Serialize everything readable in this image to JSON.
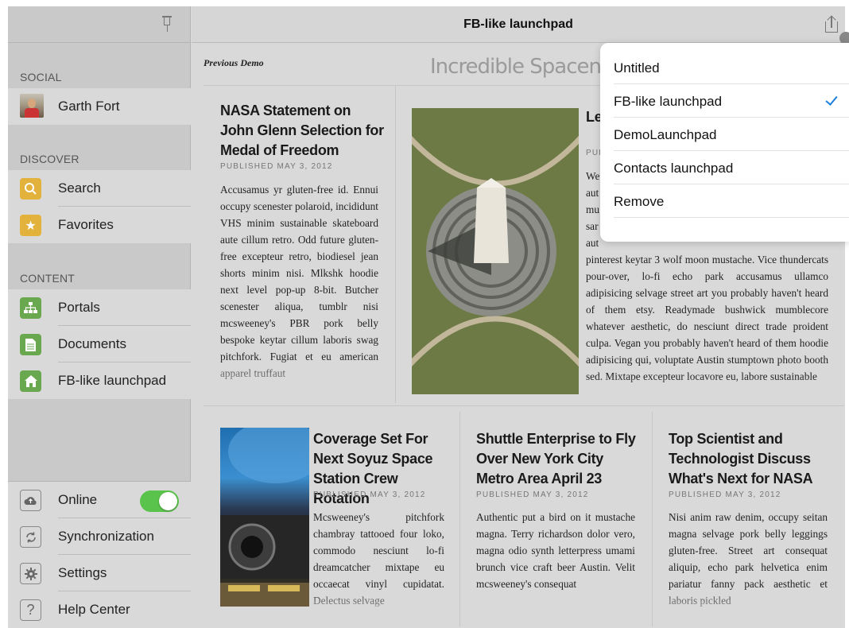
{
  "header": {
    "title": "FB-like launchpad"
  },
  "sidebar": {
    "sections": [
      {
        "label": "SOCIAL"
      },
      {
        "label": "DISCOVER"
      },
      {
        "label": "CONTENT"
      }
    ],
    "social_items": [
      {
        "label": "Garth Fort",
        "icon": "avatar"
      }
    ],
    "discover_items": [
      {
        "label": "Search",
        "icon": "search-icon"
      },
      {
        "label": "Favorites",
        "icon": "star-icon"
      }
    ],
    "content_items": [
      {
        "label": "Portals",
        "icon": "sitemap-icon"
      },
      {
        "label": "Documents",
        "icon": "document-icon"
      },
      {
        "label": "FB-like launchpad",
        "icon": "home-icon"
      }
    ],
    "bottom_items": [
      {
        "label": "Online",
        "icon": "cloud-icon",
        "toggle_on": true
      },
      {
        "label": "Synchronization",
        "icon": "sync-icon"
      },
      {
        "label": "Settings",
        "icon": "gear-icon"
      },
      {
        "label": "Help Center",
        "icon": "help-icon"
      }
    ]
  },
  "content": {
    "previous_demo": "Previous Demo",
    "magazine_title": "Incredible Spacenews",
    "articles": [
      {
        "title": "NASA Statement on John Glenn Selection for Medal of Freedom",
        "published": "PUBLISHED MAY 3, 2012",
        "body": "Accusamus yr gluten-free id. Ennui occupy scenester polaroid, incididunt VHS minim sustainable skateboard aute cillum retro. Odd future gluten-free excepteur retro, biodiesel jean shorts minim nisi. Mlkshk hoodie next level pop-up 8-bit. Butcher scenester aliqua, tumblr nisi mcsweeney's PBR pork belly bespoke keytar cillum laboris swag pitchfork. Fugiat et eu american apparel truffaut"
      },
      {
        "title": "Le Re",
        "published": "PUB",
        "body_lines": [
          "We",
          "aut",
          "mu",
          "sar",
          "aut"
        ],
        "body": "pinterest keytar 3 wolf moon mustache. Vice thundercats pour-over, lo-fi echo park accusamus ullamco adipisicing selvage street art you probably haven't heard of them etsy. Readymade bushwick mumblecore whatever aesthetic, do nesciunt direct trade proident culpa. Vegan you probably haven't heard of them hoodie adipisicing qui, voluptate Austin stumptown photo booth sed. Mixtape excepteur locavore eu, labore sustainable"
      },
      {
        "title": "Coverage Set For Next Soyuz Space Station Crew Rotation",
        "published": "PUBLISHED MAY 3, 2012",
        "body": "Mcsweeney's pitchfork chambray tattooed four loko, commodo nesciunt lo-fi dreamcatcher mixtape eu occaecat vinyl cupidatat. Delectus selvage"
      },
      {
        "title": "Shuttle Enterprise to Fly Over New York City Metro Area April 23",
        "published": "PUBLISHED MAY 3, 2012",
        "body": "Authentic put a bird on it mustache magna. Terry richardson dolor vero, magna odio synth letterpress umami brunch vice craft beer Austin. Velit mcsweeney's consequat"
      },
      {
        "title": "Top Scientist and Technologist Discuss What's Next for NASA",
        "published": "PUBLISHED MAY 3, 2012",
        "body": "Nisi anim raw denim, occupy seitan magna selvage pork belly leggings gluten-free. Street art consequat aliquip, echo park helvetica enim pariatur fanny pack aesthetic et laboris pickled"
      }
    ]
  },
  "dropdown": {
    "items": [
      {
        "label": "Untitled",
        "checked": false
      },
      {
        "label": "FB-like launchpad",
        "checked": true
      },
      {
        "label": "DemoLaunchpad",
        "checked": false
      },
      {
        "label": "Contacts launchpad",
        "checked": false
      },
      {
        "label": "Remove",
        "checked": false
      }
    ]
  },
  "colors": {
    "accent": "#1a7fe0",
    "toggle_on": "#5ac34b",
    "icon_yellow": "#e3b23c",
    "icon_green": "#6aa84f"
  }
}
